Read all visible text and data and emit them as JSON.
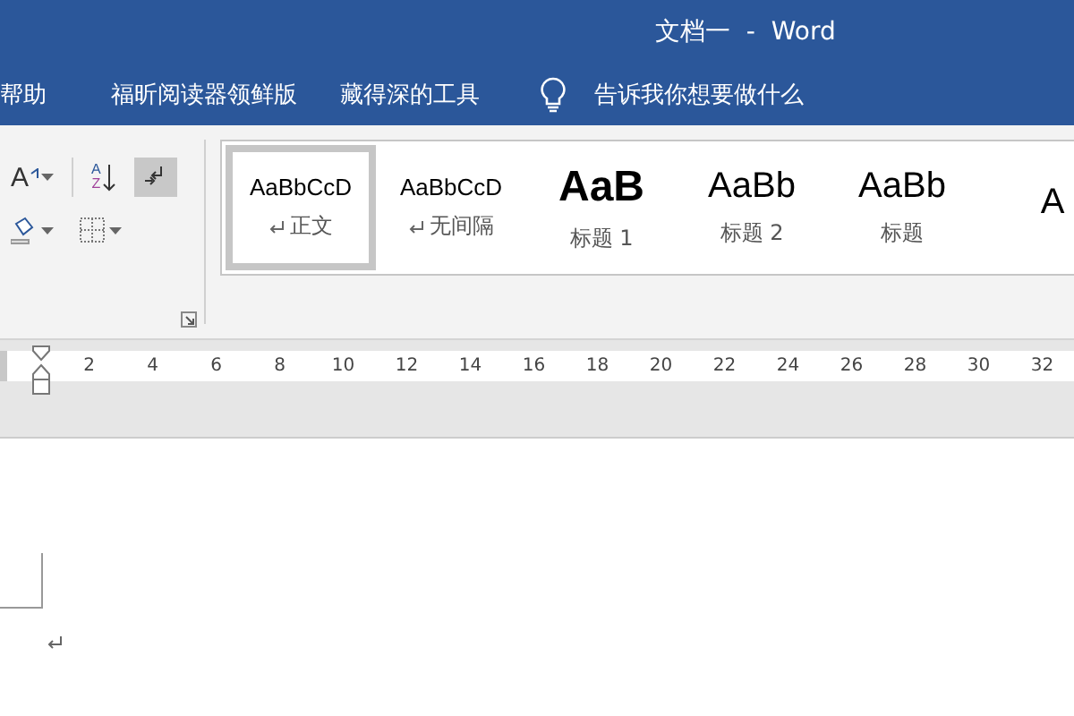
{
  "window": {
    "title": "文档一  -  Word"
  },
  "ribbon_tabs": [
    {
      "label": "帮助",
      "kind": "tab"
    },
    {
      "label": "福昕阅读器领鲜版",
      "kind": "tab"
    },
    {
      "label": "藏得深的工具",
      "kind": "tab"
    },
    {
      "label": "告诉我你想要做什么",
      "kind": "tell-me"
    }
  ],
  "paragraph_tools": [
    {
      "kind": "dropdown",
      "glyphs": [
        "A"
      ],
      "selected": false
    },
    {
      "kind": "plain",
      "glyphs": [
        "A",
        "Z"
      ],
      "selected": false
    },
    {
      "kind": "plain",
      "selected": true
    },
    {
      "kind": "dropdown",
      "selected": false
    },
    {
      "kind": "dropdown",
      "selected": false
    }
  ],
  "styles": [
    {
      "preview": "AaBbCcD",
      "label": "正文",
      "kind": "normal",
      "paragraph_mark": true,
      "selected": true
    },
    {
      "preview": "AaBbCcD",
      "label": "无间隔",
      "kind": "normal",
      "paragraph_mark": true,
      "selected": false
    },
    {
      "preview": "AaB",
      "label": "标题 1",
      "kind": "heading1",
      "paragraph_mark": false,
      "selected": false
    },
    {
      "preview": "AaBb",
      "label": "标题 2",
      "kind": "heading2",
      "paragraph_mark": false,
      "selected": false
    },
    {
      "preview": "AaBb",
      "label": "标题",
      "kind": "heading2",
      "paragraph_mark": false,
      "selected": false
    },
    {
      "preview": "A",
      "kind": "heading2",
      "paragraph_mark": false,
      "selected": false
    }
  ],
  "ruler": {
    "ticks": [
      "2",
      "4",
      "6",
      "8",
      "10",
      "12",
      "14",
      "16",
      "18",
      "20",
      "22",
      "24",
      "26",
      "28",
      "30",
      "32"
    ]
  },
  "document": {
    "paragraph_mark": true
  }
}
